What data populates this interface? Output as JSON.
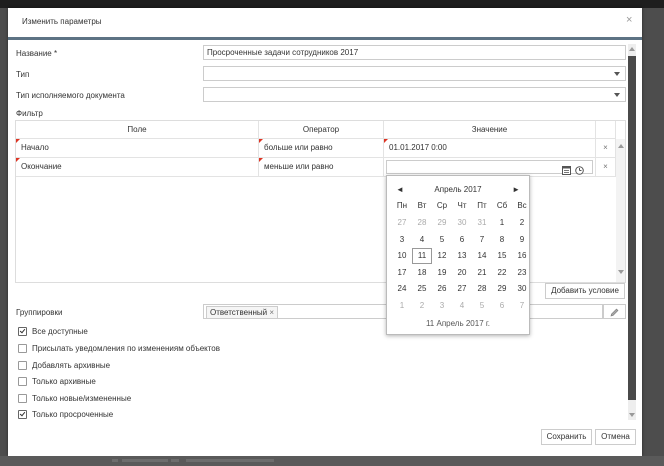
{
  "dialog": {
    "title": "Изменить параметры",
    "close": "×"
  },
  "form": {
    "name_label": "Название *",
    "name_value": "Просроченные задачи сотрудников 2017",
    "type_label": "Тип",
    "type_value": "",
    "doc_type_label": "Тип исполняемого документа",
    "doc_type_value": "",
    "filter_label": "Фильтр"
  },
  "filter": {
    "columns": [
      "Поле",
      "Оператор",
      "Значение"
    ],
    "rows": [
      {
        "field": "Начало",
        "operator": "больше или равно",
        "value": "01.01.2017 0:00",
        "remove": "×"
      },
      {
        "field": "Окончание",
        "operator": "меньше или равно",
        "value": "",
        "remove": "×"
      }
    ],
    "add_condition": "Добавить условие"
  },
  "calendar": {
    "prev": "◄",
    "next": "►",
    "month": "Апрель 2017",
    "weekdays": [
      "Пн",
      "Вт",
      "Ср",
      "Чт",
      "Пт",
      "Сб",
      "Вс"
    ],
    "weeks": [
      [
        27,
        28,
        29,
        30,
        31,
        1,
        2
      ],
      [
        3,
        4,
        5,
        6,
        7,
        8,
        9
      ],
      [
        10,
        11,
        12,
        13,
        14,
        15,
        16
      ],
      [
        17,
        18,
        19,
        20,
        21,
        22,
        23
      ],
      [
        24,
        25,
        26,
        27,
        28,
        29,
        30
      ],
      [
        1,
        2,
        3,
        4,
        5,
        6,
        7
      ]
    ],
    "selected_day": 11,
    "today_label": "11 Апрель 2017 г."
  },
  "grouping": {
    "label": "Группировки",
    "tags": [
      {
        "label": "Ответственный",
        "remove": "×"
      }
    ]
  },
  "options": [
    {
      "label": "Все доступные",
      "checked": true
    },
    {
      "label": "Присылать уведомления по изменениям объектов",
      "checked": false
    },
    {
      "label": "Добавлять архивные",
      "checked": false
    },
    {
      "label": "Только архивные",
      "checked": false
    },
    {
      "label": "Только новые/измененные",
      "checked": false
    },
    {
      "label": "Только просроченные",
      "checked": true
    }
  ],
  "buttons": {
    "save": "Сохранить",
    "cancel": "Отмена"
  },
  "colors": {
    "header_rule": "#5d7384",
    "modified_marker": "#dd3322",
    "scroll_thumb": "#4a4a4a"
  }
}
